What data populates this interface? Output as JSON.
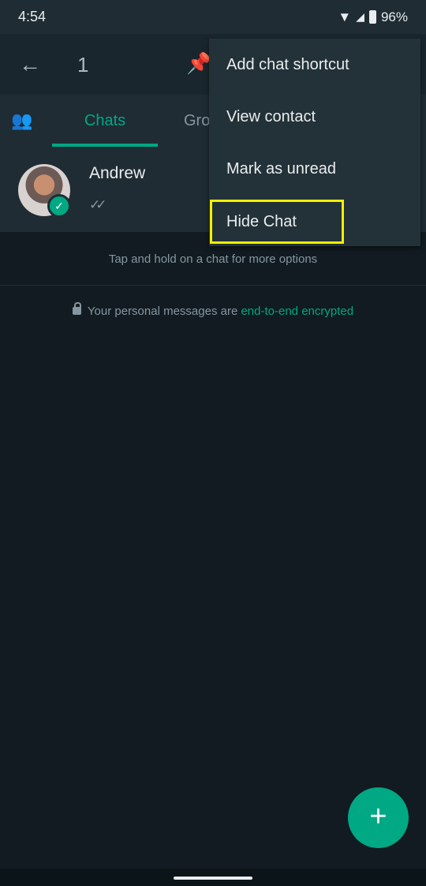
{
  "status_bar": {
    "time": "4:54",
    "battery": "96%",
    "icons": [
      "wifi-icon",
      "signal-roaming-icon",
      "battery-charging-icon"
    ]
  },
  "header": {
    "selected_count": "1",
    "icons": [
      "back-arrow-icon",
      "pin-icon"
    ]
  },
  "tabs": [
    {
      "label": "Chats",
      "active": true
    },
    {
      "label": "Gro"
    }
  ],
  "chats": [
    {
      "name": "Andrew",
      "status": "read-double-tick"
    }
  ],
  "hint": "Tap and hold on a chat for more options",
  "encryption": {
    "prefix": "Your personal messages are ",
    "link": "end-to-end encrypted"
  },
  "menu": {
    "items": [
      "Add chat shortcut",
      "View contact",
      "Mark as unread",
      "Hide Chat"
    ],
    "highlighted": "Hide Chat",
    "highlight_color": "#f5f000"
  },
  "fab": {
    "icon": "plus-icon"
  },
  "colors": {
    "accent": "#00a884",
    "background": "#111b21",
    "surface": "#1f2c34"
  }
}
